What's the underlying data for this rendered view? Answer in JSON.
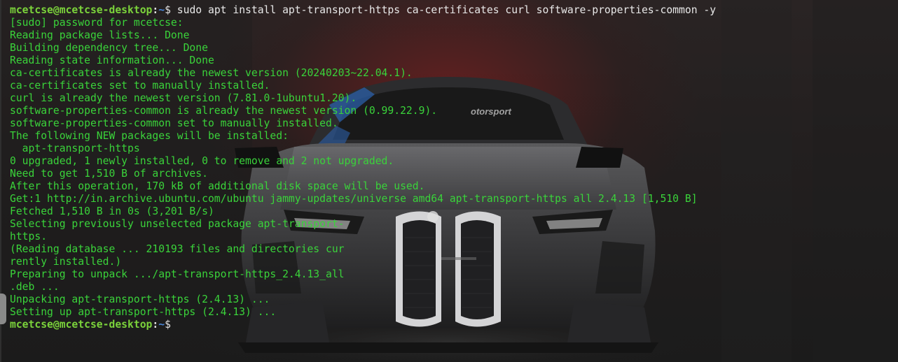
{
  "terminal": {
    "prompt_user_host": "mcetcse@mcetcse-desktop",
    "prompt_sep": ":",
    "prompt_path": "~",
    "prompt_dollar": "$ ",
    "command": "sudo apt install apt-transport-https ca-certificates curl software-properties-common -y",
    "output_lines": [
      "[sudo] password for mcetcse:",
      "Reading package lists... Done",
      "Building dependency tree... Done",
      "Reading state information... Done",
      "ca-certificates is already the newest version (20240203~22.04.1).",
      "ca-certificates set to manually installed.",
      "curl is already the newest version (7.81.0-1ubuntu1.20).",
      "software-properties-common is already the newest version (0.99.22.9).",
      "software-properties-common set to manually installed.",
      "The following NEW packages will be installed:",
      "  apt-transport-https",
      "0 upgraded, 1 newly installed, 0 to remove and 2 not upgraded.",
      "Need to get 1,510 B of archives.",
      "After this operation, 170 kB of additional disk space will be used.",
      "Get:1 http://in.archive.ubuntu.com/ubuntu jammy-updates/universe amd64 apt-transport-https all 2.4.13 [1,510 B]",
      "Fetched 1,510 B in 0s (3,201 B/s)",
      "Selecting previously unselected package apt-transport-",
      "https.",
      "(Reading database ... 210193 files and directories cur",
      "rently installed.)",
      "Preparing to unpack .../apt-transport-https_2.4.13_all",
      ".deb ...",
      "Unpacking apt-transport-https (2.4.13) ...",
      "Setting up apt-transport-https (2.4.13) ..."
    ],
    "final_prompt_user_host": "mcetcse@mcetcse-desktop",
    "final_prompt_sep": ":",
    "final_prompt_path": "~",
    "final_prompt_dollar": "$"
  },
  "wallpaper": {
    "description_icon": "race-car-wallpaper-icon",
    "car_text": "otorsport"
  },
  "colors": {
    "output_green": "#3ad33a",
    "prompt_green": "#7bd33b",
    "prompt_blue": "#4a86d8",
    "background": "#1c1c1c"
  }
}
